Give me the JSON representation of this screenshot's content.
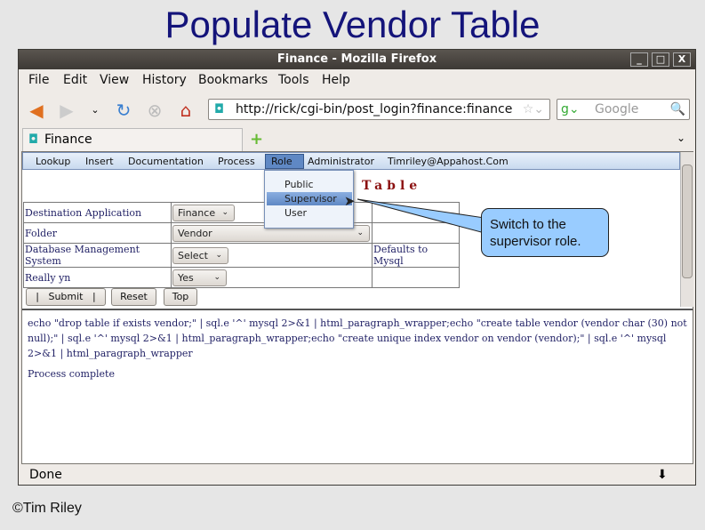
{
  "slide": {
    "title": "Populate Vendor Table",
    "copyright": "©Tim Riley",
    "callout": "Switch to the supervisor role."
  },
  "window": {
    "title": "Finance - Mozilla Firefox",
    "min": "_",
    "max": "□",
    "close": "X"
  },
  "menubar": [
    "File",
    "Edit",
    "View",
    "History",
    "Bookmarks",
    "Tools",
    "Help"
  ],
  "nav": {
    "url": "http://rick/cgi-bin/post_login?finance:finance",
    "search_placeholder": "Google"
  },
  "tab": {
    "label": "Finance"
  },
  "appmenu": [
    "Lookup",
    "Insert",
    "Documentation",
    "Process",
    "Role",
    "Administrator",
    "Timriley@Appahost.Com"
  ],
  "role_menu": {
    "items": [
      "Public",
      "Supervisor",
      "User"
    ],
    "highlighted": "Supervisor"
  },
  "heading": "Table",
  "form": {
    "rows": [
      {
        "label": "Destination Application",
        "value": "Finance",
        "note": ""
      },
      {
        "label": "Folder",
        "value": "Vendor",
        "note": ""
      },
      {
        "label": "Database Management System",
        "value": "Select",
        "note": "Defaults to Mysql"
      },
      {
        "label": "Really yn",
        "value": "Yes",
        "note": ""
      }
    ],
    "submit": "|   Submit   |",
    "reset": "Reset",
    "top": "Top"
  },
  "output": {
    "command": "echo \"drop table if exists vendor;\" | sql.e '^' mysql 2>&1 | html_paragraph_wrapper;echo \"create table vendor (vendor char (30) not null);\" | sql.e '^' mysql 2>&1 | html_paragraph_wrapper;echo \"create unique index vendor on vendor (vendor);\" | sql.e '^' mysql 2>&1 | html_paragraph_wrapper",
    "status": "Process complete"
  },
  "statusbar": {
    "text": "Done"
  },
  "colors": {
    "title": "#14147a",
    "callout": "#99ccff",
    "heading": "#8b1010"
  }
}
